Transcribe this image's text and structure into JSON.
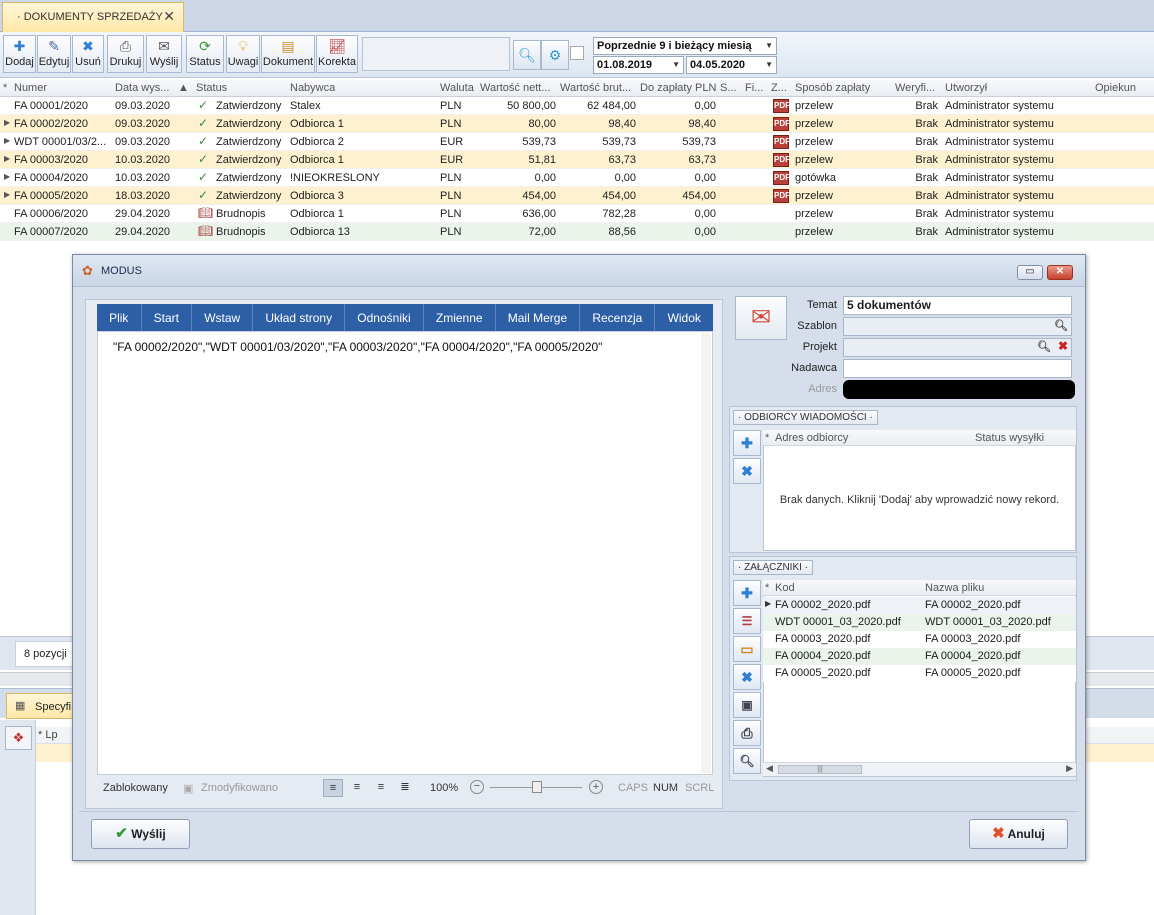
{
  "tab": {
    "title": "· DOKUMENTY SPRZEDAŻY ·"
  },
  "toolbar": {
    "buttons": [
      "Dodaj",
      "Edytuj",
      "Usuń",
      "Drukuj",
      "Wyślij",
      "Status",
      "Uwagi",
      "Dokument",
      "Korekta"
    ],
    "period": "Poprzednie 9 i bieżący miesią",
    "date_from": "01.08.2019",
    "date_to": "04.05.2020"
  },
  "grid": {
    "headers": [
      "Numer",
      "Data wys...",
      "Status",
      "Nabywca",
      "Waluta",
      "Wartość nett...",
      "Wartość brut...",
      "Do zapłaty PLN",
      "S...",
      "Fi...",
      "Z...",
      "Sposób zapłaty",
      "Weryfi...",
      "Utworzył",
      "Opiekun"
    ],
    "rows": [
      {
        "numer": "FA 00001/2020",
        "data": "09.03.2020",
        "status": "Zatwierdzony",
        "nabywca": "Stalex",
        "waluta": "PLN",
        "netto": "50 800,00",
        "brutto": "62 484,00",
        "zaplata": "0,00",
        "pdf": "PDF",
        "sposob": "przelew",
        "weryf": "Brak",
        "utworzyl": "Administrator systemu"
      },
      {
        "numer": "FA 00002/2020",
        "data": "09.03.2020",
        "status": "Zatwierdzony",
        "nabywca": "Odbiorca 1",
        "waluta": "PLN",
        "netto": "80,00",
        "brutto": "98,40",
        "zaplata": "98,40",
        "pdf": "PDF",
        "sposob": "przelew",
        "weryf": "Brak",
        "utworzyl": "Administrator systemu"
      },
      {
        "numer": "WDT 00001/03/2...",
        "data": "09.03.2020",
        "status": "Zatwierdzony",
        "nabywca": "Odbiorca 2",
        "waluta": "EUR",
        "netto": "539,73",
        "brutto": "539,73",
        "zaplata": "539,73",
        "pdf": "PDF",
        "sposob": "przelew",
        "weryf": "Brak",
        "utworzyl": "Administrator systemu"
      },
      {
        "numer": "FA 00003/2020",
        "data": "10.03.2020",
        "status": "Zatwierdzony",
        "nabywca": "Odbiorca 1",
        "waluta": "EUR",
        "netto": "51,81",
        "brutto": "63,73",
        "zaplata": "63,73",
        "pdf": "PDF",
        "sposob": "przelew",
        "weryf": "Brak",
        "utworzyl": "Administrator systemu"
      },
      {
        "numer": "FA 00004/2020",
        "data": "10.03.2020",
        "status": "Zatwierdzony",
        "nabywca": "!NIEOKREŚLONY",
        "waluta": "PLN",
        "netto": "0,00",
        "brutto": "0,00",
        "zaplata": "0,00",
        "pdf": "PDF",
        "sposob": "gotówka",
        "weryf": "Brak",
        "utworzyl": "Administrator systemu"
      },
      {
        "numer": "FA 00005/2020",
        "data": "18.03.2020",
        "status": "Zatwierdzony",
        "nabywca": "Odbiorca 3",
        "waluta": "PLN",
        "netto": "454,00",
        "brutto": "454,00",
        "zaplata": "454,00",
        "pdf": "PDF",
        "sposob": "przelew",
        "weryf": "Brak",
        "utworzyl": "Administrator systemu"
      },
      {
        "numer": "FA 00006/2020",
        "data": "29.04.2020",
        "status": "Brudnopis",
        "nabywca": "Odbiorca 1",
        "waluta": "PLN",
        "netto": "636,00",
        "brutto": "782,28",
        "zaplata": "0,00",
        "pdf": "",
        "sposob": "przelew",
        "weryf": "Brak",
        "utworzyl": "Administrator systemu"
      },
      {
        "numer": "FA 00007/2020",
        "data": "29.04.2020",
        "status": "Brudnopis",
        "nabywca": "Odbiorca 13",
        "waluta": "PLN",
        "netto": "72,00",
        "brutto": "88,56",
        "zaplata": "0,00",
        "pdf": "",
        "sposob": "przelew",
        "weryf": "Brak",
        "utworzyl": "Administrator systemu"
      }
    ]
  },
  "background": {
    "count": "8 pozycji",
    "subtab": "Specyfi",
    "sub_col": "Lp"
  },
  "dialog": {
    "title": "MODUS",
    "ribbon_tabs": [
      "Plik",
      "Start",
      "Wstaw",
      "Układ strony",
      "Odnośniki",
      "Zmienne",
      "Mail Merge",
      "Recenzja",
      "Widok"
    ],
    "body_text": "\"FA 00002/2020\",\"WDT 00001/03/2020\",\"FA 00003/2020\",\"FA 00004/2020\",\"FA 00005/2020\"",
    "editor_status": {
      "locked": "Zablokowany",
      "modified": "Zmodyfikowano",
      "zoom": "100%",
      "caps": "CAPS",
      "num": "NUM",
      "scrl": "SCRL"
    },
    "labels": {
      "temat": "Temat",
      "szablon": "Szablon",
      "projekt": "Projekt",
      "nadawca": "Nadawca",
      "adres": "Adres"
    },
    "temat_value": "5 dokumentów",
    "recipients": {
      "header": "· ODBIORCY WIADOMOŚCI ·",
      "col1": "Adres odbiorcy",
      "col2": "Status wysyłki",
      "empty": "Brak danych. Kliknij 'Dodaj' aby wprowadzić nowy rekord."
    },
    "attachments": {
      "header": "· ZAŁĄCZNIKI ·",
      "col1": "Kod",
      "col2": "Nazwa pliku",
      "rows": [
        {
          "kod": "FA 00002_2020.pdf",
          "plik": "FA 00002_2020.pdf"
        },
        {
          "kod": "WDT 00001_03_2020.pdf",
          "plik": "WDT 00001_03_2020.pdf"
        },
        {
          "kod": "FA 00003_2020.pdf",
          "plik": "FA 00003_2020.pdf"
        },
        {
          "kod": "FA 00004_2020.pdf",
          "plik": "FA 00004_2020.pdf"
        },
        {
          "kod": "FA 00005_2020.pdf",
          "plik": "FA 00005_2020.pdf"
        }
      ]
    },
    "send_label": "Wyślij",
    "cancel_label": "Anuluj"
  }
}
